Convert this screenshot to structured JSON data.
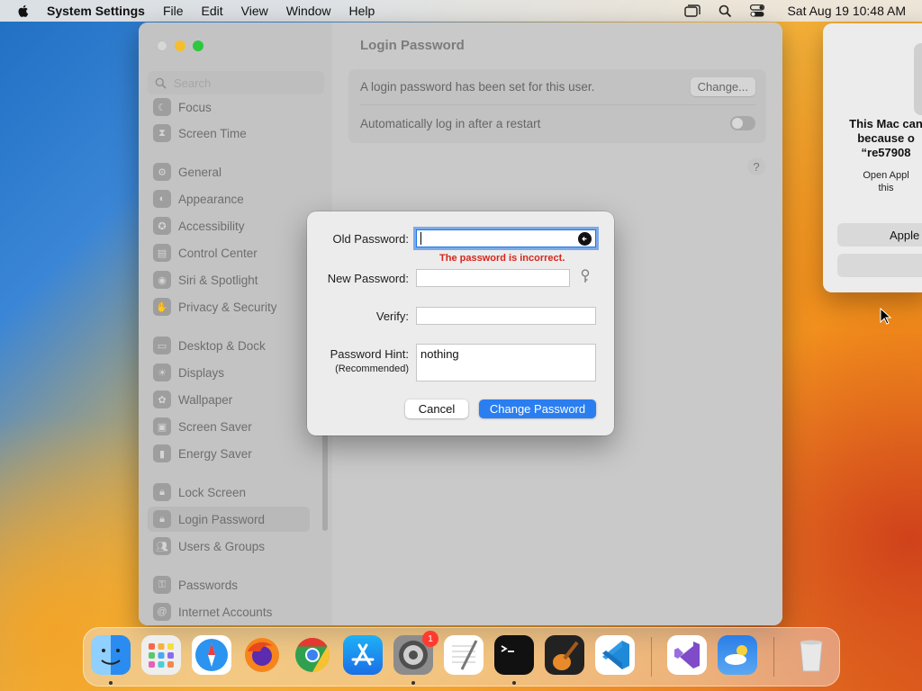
{
  "menubar": {
    "app_name": "System Settings",
    "items": [
      "File",
      "Edit",
      "View",
      "Window",
      "Help"
    ],
    "clock": "Sat Aug 19  10:48 AM"
  },
  "window": {
    "title": "Login Password",
    "search_placeholder": "Search",
    "sidebar": [
      {
        "label": "Focus",
        "icon": "moon-icon",
        "color": "#7a6bbd"
      },
      {
        "label": "Screen Time",
        "icon": "hourglass-icon",
        "color": "#8e7fc6"
      },
      {
        "label": "General",
        "icon": "gear-icon",
        "color": "#9a9a9a"
      },
      {
        "label": "Appearance",
        "icon": "appearance-icon",
        "color": "#555555"
      },
      {
        "label": "Accessibility",
        "icon": "accessibility-icon",
        "color": "#4c8ad8"
      },
      {
        "label": "Control Center",
        "icon": "control-center-icon",
        "color": "#9a9a9a"
      },
      {
        "label": "Siri & Spotlight",
        "icon": "siri-icon",
        "color": "#b36cc5"
      },
      {
        "label": "Privacy & Security",
        "icon": "hand-icon",
        "color": "#4c8ad8"
      },
      {
        "label": "Desktop & Dock",
        "icon": "dock-icon",
        "color": "#333333"
      },
      {
        "label": "Displays",
        "icon": "sun-icon",
        "color": "#4c8ad8"
      },
      {
        "label": "Wallpaper",
        "icon": "wallpaper-icon",
        "color": "#5fb3e0"
      },
      {
        "label": "Screen Saver",
        "icon": "screen-saver-icon",
        "color": "#5fb3e0"
      },
      {
        "label": "Energy Saver",
        "icon": "battery-icon",
        "color": "#e8b23a"
      },
      {
        "label": "Lock Screen",
        "icon": "lock-icon",
        "color": "#333333"
      },
      {
        "label": "Login Password",
        "icon": "lock-icon",
        "color": "#9a9a9a",
        "selected": true
      },
      {
        "label": "Users & Groups",
        "icon": "users-icon",
        "color": "#4c8ad8"
      },
      {
        "label": "Passwords",
        "icon": "key-icon",
        "color": "#9a9a9a"
      },
      {
        "label": "Internet Accounts",
        "icon": "at-icon",
        "color": "#4c8ad8"
      }
    ],
    "row_password_text": "A login password has been set for this user.",
    "change_button": "Change...",
    "row_autologin_text": "Automatically log in after a restart",
    "help": "?"
  },
  "sheet": {
    "old_label": "Old Password:",
    "old_value": "",
    "error": "The password is incorrect.",
    "new_label": "New Password:",
    "verify_label": "Verify:",
    "hint_label": "Password Hint:",
    "hint_sub": "(Recommended)",
    "hint_value": "nothing",
    "cancel": "Cancel",
    "confirm": "Change Password"
  },
  "alert": {
    "title_lines": [
      "This Mac can",
      "because o",
      "“re57908"
    ],
    "message_lines": [
      "Open Appl",
      "this"
    ],
    "button1": "Apple"
  },
  "dock": {
    "apps": [
      "Finder",
      "Launchpad",
      "Safari",
      "Firefox",
      "Chrome",
      "App Store",
      "System Settings",
      "TextEdit",
      "Terminal",
      "GarageBand",
      "Visual Studio Code",
      "Visual Studio",
      "Weather",
      "Trash"
    ],
    "settings_badge": "1"
  }
}
